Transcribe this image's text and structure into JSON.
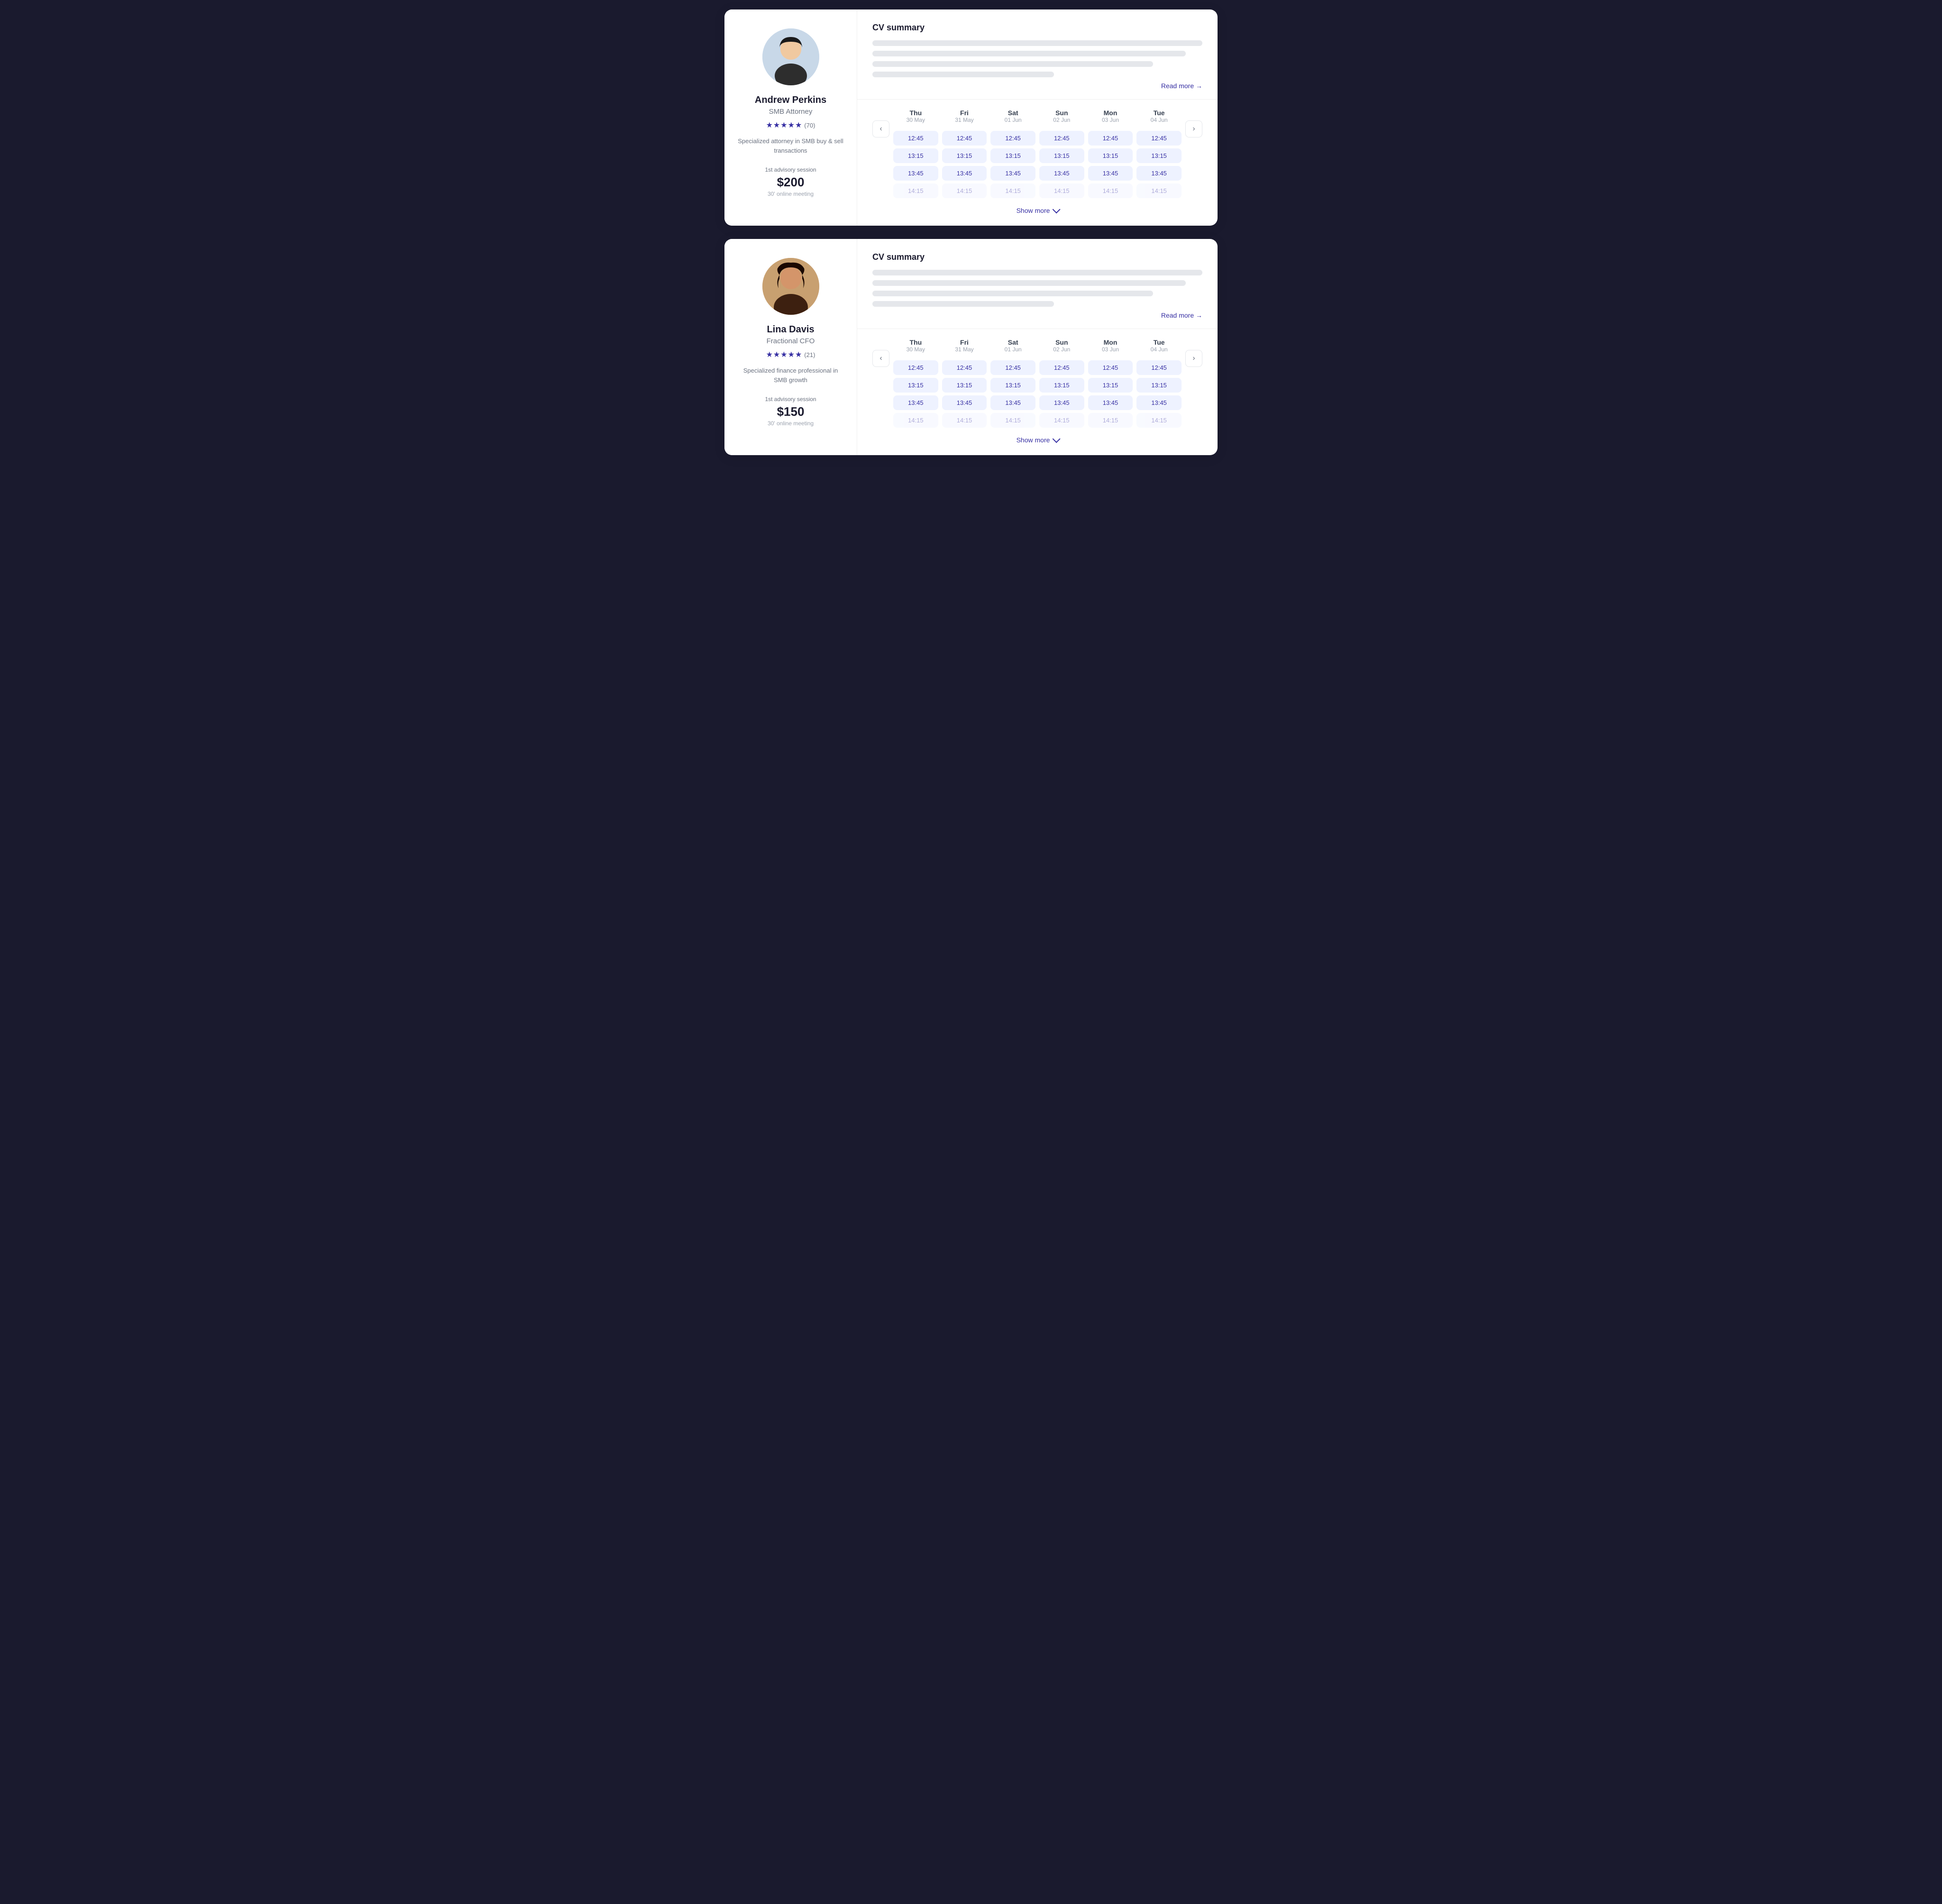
{
  "cards": [
    {
      "id": "card-andrew",
      "profile": {
        "name": "Andrew Perkins",
        "role": "SMB Attorney",
        "stars": 5,
        "review_count": "(70)",
        "bio": "Specialized attorney in SMB buy & sell transactions",
        "session_label": "1st advisory session",
        "price": "$200",
        "session_desc": "30' online meeting",
        "avatar_type": "male"
      },
      "cv": {
        "title": "CV summary",
        "read_more_label": "Read more →"
      },
      "calendar": {
        "days": [
          {
            "name": "Thu",
            "date": "30 May"
          },
          {
            "name": "Fri",
            "date": "31 May"
          },
          {
            "name": "Sat",
            "date": "01 Jun"
          },
          {
            "name": "Sun",
            "date": "02 Jun"
          },
          {
            "name": "Mon",
            "date": "03 Jun"
          },
          {
            "name": "Tue",
            "date": "04 Jun"
          }
        ],
        "slots": [
          "12:45",
          "13:15",
          "13:45"
        ],
        "show_more_label": "Show more"
      }
    },
    {
      "id": "card-lina",
      "profile": {
        "name": "Lina Davis",
        "role": "Fractional CFO",
        "stars": 5,
        "review_count": "(21)",
        "bio": "Specialized finance professional in SMB growth",
        "session_label": "1st advisory session",
        "price": "$150",
        "session_desc": "30' online meeting",
        "avatar_type": "female"
      },
      "cv": {
        "title": "CV summary",
        "read_more_label": "Read more →"
      },
      "calendar": {
        "days": [
          {
            "name": "Thu",
            "date": "30 May"
          },
          {
            "name": "Fri",
            "date": "31 May"
          },
          {
            "name": "Sat",
            "date": "01 Jun"
          },
          {
            "name": "Sun",
            "date": "02 Jun"
          },
          {
            "name": "Mon",
            "date": "03 Jun"
          },
          {
            "name": "Tue",
            "date": "04 Jun"
          }
        ],
        "slots": [
          "12:45",
          "13:15",
          "13:45"
        ],
        "show_more_label": "Show more"
      }
    }
  ]
}
